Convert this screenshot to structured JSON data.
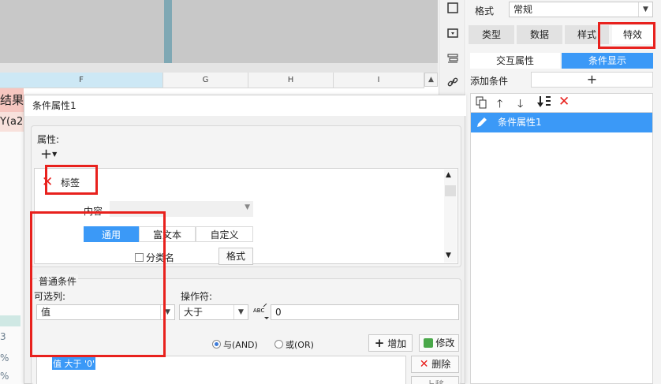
{
  "sheet": {
    "columns": [
      "F",
      "G",
      "H",
      "I"
    ],
    "cell_result": "结果",
    "cell_formula": "Y(a2",
    "side_values": [
      "3",
      "%",
      "%"
    ]
  },
  "panel": {
    "style_label": "格式",
    "style_value": "常规",
    "tabs": [
      "类型",
      "数据",
      "样式",
      "特效"
    ],
    "subtabs": [
      "交互属性",
      "条件显示"
    ],
    "add_condition_label": "添加条件",
    "add_symbol": "+",
    "list_items": [
      "条件属性1"
    ]
  },
  "dialog": {
    "title": "条件属性1",
    "attributes_label": "属性:",
    "add_symbol": "+",
    "tag_label": "标签",
    "content_label": "内容",
    "segments": [
      "通用",
      "富文本",
      "自定义"
    ],
    "category_name_label": "分类名",
    "format_button": "格式",
    "condition_group_label": "普通条件",
    "optional_column_label": "可选列:",
    "operator_label": "操作符:",
    "column_value": "值",
    "operator_value": "大于",
    "value_input": "0",
    "and_label": "与(AND)",
    "or_label": "或(OR)",
    "add_button": "增加",
    "modify_button": "修改",
    "delete_button": "删除",
    "move_button": "上移",
    "condition_item": "值 大于 '0'"
  },
  "colors": {
    "accent": "#3b99f7",
    "highlight_red": "#e8211d"
  }
}
